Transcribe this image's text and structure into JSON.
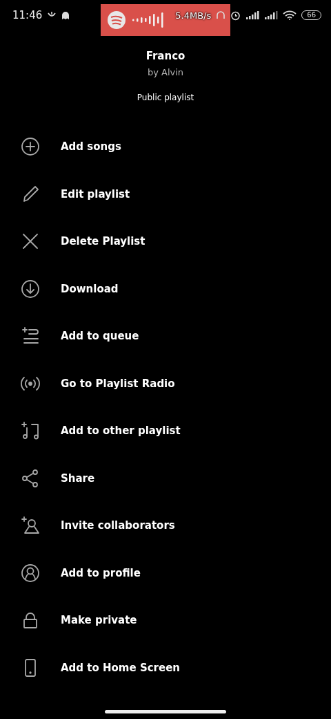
{
  "status_bar": {
    "time": "11:46",
    "speed": "5.4MB/s",
    "battery": "66"
  },
  "playlist": {
    "title": "Franco",
    "owner": "by Alvin",
    "visibility": "Public playlist"
  },
  "menu": [
    {
      "kind": "add",
      "label": "Add songs"
    },
    {
      "kind": "edit",
      "label": "Edit playlist"
    },
    {
      "kind": "delete",
      "label": "Delete Playlist"
    },
    {
      "kind": "download",
      "label": "Download"
    },
    {
      "kind": "queue",
      "label": "Add to queue"
    },
    {
      "kind": "radio",
      "label": "Go to Playlist Radio"
    },
    {
      "kind": "other_playlist",
      "label": "Add to other playlist"
    },
    {
      "kind": "share",
      "label": "Share"
    },
    {
      "kind": "invite",
      "label": "Invite collaborators"
    },
    {
      "kind": "profile",
      "label": "Add to profile"
    },
    {
      "kind": "private",
      "label": "Make private"
    },
    {
      "kind": "home_screen",
      "label": "Add to Home Screen"
    }
  ]
}
